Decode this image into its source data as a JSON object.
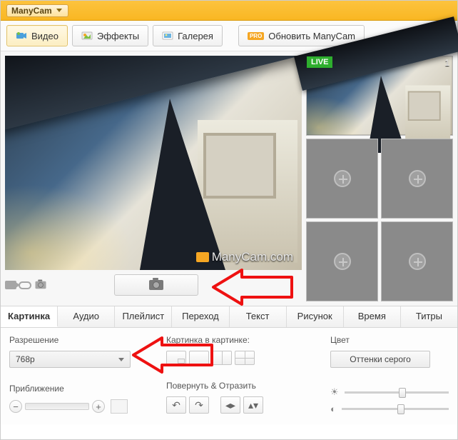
{
  "app": {
    "title": "ManyCam"
  },
  "toolbar": {
    "video": "Видео",
    "effects": "Эффекты",
    "gallery": "Галерея",
    "upgrade": "Обновить ManyCam",
    "pro_badge": "PRO"
  },
  "watermark": "ManyCam.com",
  "sources": {
    "live_label": "LIVE",
    "num1": "1"
  },
  "tabs": [
    "Картинка",
    "Аудио",
    "Плейлист",
    "Переход",
    "Текст",
    "Рисунок",
    "Время",
    "Титры"
  ],
  "settings": {
    "resolution_label": "Разрешение",
    "resolution_value": "768p",
    "zoom_label": "Приближение",
    "pip_label": "Картинка в картинке:",
    "rotate_label": "Повернуть & Отразить",
    "color_label": "Цвет",
    "grayscale_btn": "Оттенки серого"
  }
}
